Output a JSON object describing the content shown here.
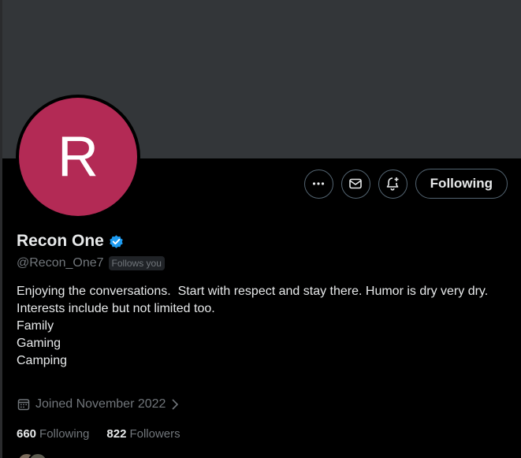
{
  "profile": {
    "avatar_letter": "R",
    "avatar_color": "#b32a55",
    "display_name": "Recon One",
    "verified_icon": "verified-badge-icon",
    "verified_color": "#1d9bf0",
    "handle": "@Recon_One7",
    "follows_you_label": "Follows you",
    "bio_lines": [
      "Enjoying the conversations.  Start with respect and stay there. Humor is dry very dry.",
      "Interests include but not limited too.",
      "Family",
      "Gaming",
      "Camping"
    ],
    "joined_text": "Joined November 2022",
    "following_count": "660",
    "following_label": "Following",
    "followers_count": "822",
    "followers_label": "Followers"
  },
  "actions": {
    "more_icon": "more-icon",
    "message_icon": "envelope-icon",
    "notify_icon": "bell-plus-icon",
    "follow_button_label": "Following"
  }
}
